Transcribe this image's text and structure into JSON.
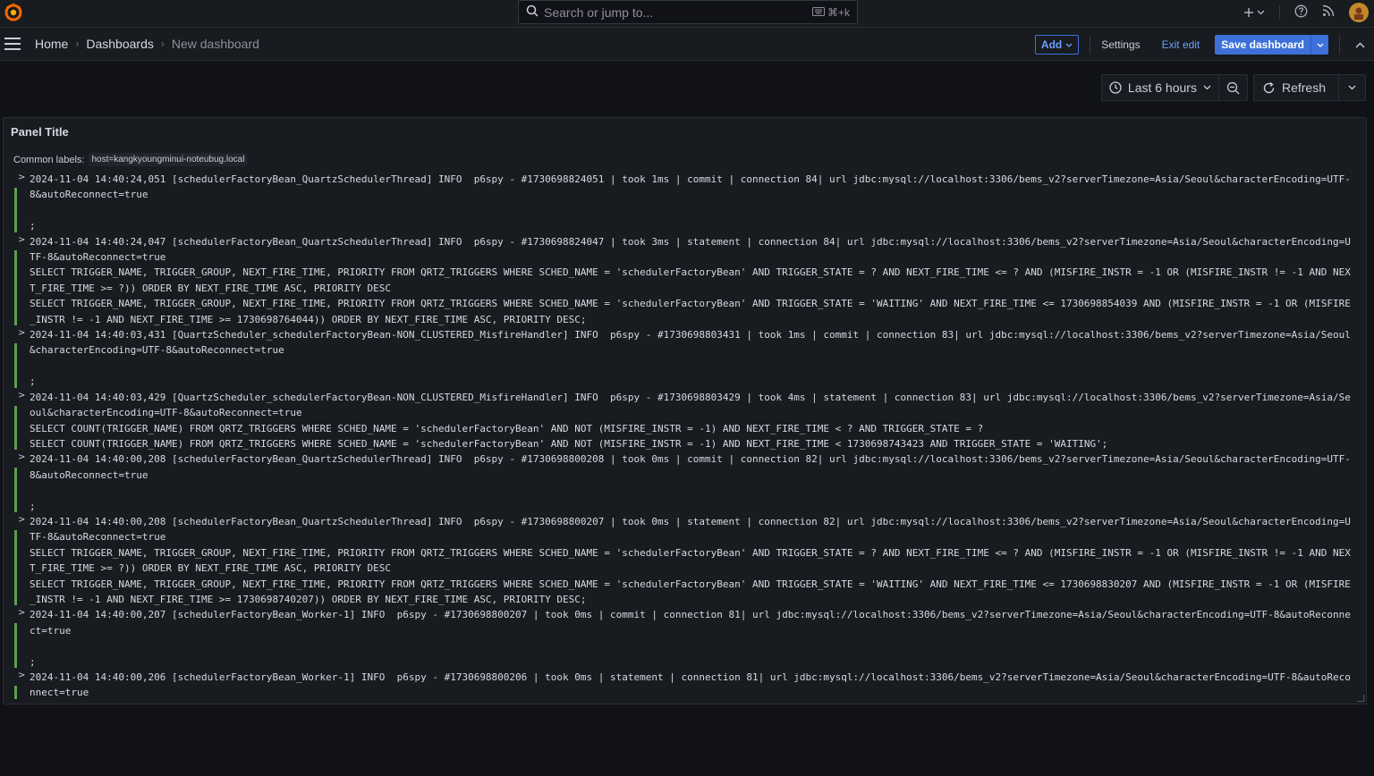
{
  "search": {
    "placeholder": "Search or jump to...",
    "shortcut": "⌘+k"
  },
  "topbar": {
    "add_icon": "plus-icon",
    "help_icon": "help-icon",
    "news_icon": "rss-icon"
  },
  "breadcrumb": {
    "home": "Home",
    "dashboards": "Dashboards",
    "current": "New dashboard"
  },
  "toolbar": {
    "add_label": "Add",
    "settings_label": "Settings",
    "exit_label": "Exit edit",
    "save_label": "Save dashboard"
  },
  "timepicker": {
    "range_label": "Last 6 hours",
    "refresh_label": "Refresh"
  },
  "panel": {
    "title": "Panel Title",
    "common_labels_label": "Common labels:",
    "common_label_value": "host=kangkyoungminui-noteubug.local"
  },
  "colors": {
    "accent": "#3d71d9",
    "log_level_info": "#5c9e52",
    "background": "#111217"
  },
  "logs": [
    {
      "text": "2024-11-04 14:40:24,051 [schedulerFactoryBean_QuartzSchedulerThread] INFO  p6spy - #1730698824051 | took 1ms | commit | connection 84| url jdbc:mysql://localhost:3306/bems_v2?serverTimezone=Asia/Seoul&characterEncoding=UTF-8&autoReconnect=true\n\n;"
    },
    {
      "text": "2024-11-04 14:40:24,047 [schedulerFactoryBean_QuartzSchedulerThread] INFO  p6spy - #1730698824047 | took 3ms | statement | connection 84| url jdbc:mysql://localhost:3306/bems_v2?serverTimezone=Asia/Seoul&characterEncoding=UTF-8&autoReconnect=true\nSELECT TRIGGER_NAME, TRIGGER_GROUP, NEXT_FIRE_TIME, PRIORITY FROM QRTZ_TRIGGERS WHERE SCHED_NAME = 'schedulerFactoryBean' AND TRIGGER_STATE = ? AND NEXT_FIRE_TIME <= ? AND (MISFIRE_INSTR = -1 OR (MISFIRE_INSTR != -1 AND NEXT_FIRE_TIME >= ?)) ORDER BY NEXT_FIRE_TIME ASC, PRIORITY DESC\nSELECT TRIGGER_NAME, TRIGGER_GROUP, NEXT_FIRE_TIME, PRIORITY FROM QRTZ_TRIGGERS WHERE SCHED_NAME = 'schedulerFactoryBean' AND TRIGGER_STATE = 'WAITING' AND NEXT_FIRE_TIME <= 1730698854039 AND (MISFIRE_INSTR = -1 OR (MISFIRE_INSTR != -1 AND NEXT_FIRE_TIME >= 1730698764044)) ORDER BY NEXT_FIRE_TIME ASC, PRIORITY DESC;"
    },
    {
      "text": "2024-11-04 14:40:03,431 [QuartzScheduler_schedulerFactoryBean-NON_CLUSTERED_MisfireHandler] INFO  p6spy - #1730698803431 | took 1ms | commit | connection 83| url jdbc:mysql://localhost:3306/bems_v2?serverTimezone=Asia/Seoul&characterEncoding=UTF-8&autoReconnect=true\n\n;"
    },
    {
      "text": "2024-11-04 14:40:03,429 [QuartzScheduler_schedulerFactoryBean-NON_CLUSTERED_MisfireHandler] INFO  p6spy - #1730698803429 | took 4ms | statement | connection 83| url jdbc:mysql://localhost:3306/bems_v2?serverTimezone=Asia/Seoul&characterEncoding=UTF-8&autoReconnect=true\nSELECT COUNT(TRIGGER_NAME) FROM QRTZ_TRIGGERS WHERE SCHED_NAME = 'schedulerFactoryBean' AND NOT (MISFIRE_INSTR = -1) AND NEXT_FIRE_TIME < ? AND TRIGGER_STATE = ?\nSELECT COUNT(TRIGGER_NAME) FROM QRTZ_TRIGGERS WHERE SCHED_NAME = 'schedulerFactoryBean' AND NOT (MISFIRE_INSTR = -1) AND NEXT_FIRE_TIME < 1730698743423 AND TRIGGER_STATE = 'WAITING';"
    },
    {
      "text": "2024-11-04 14:40:00,208 [schedulerFactoryBean_QuartzSchedulerThread] INFO  p6spy - #1730698800208 | took 0ms | commit | connection 82| url jdbc:mysql://localhost:3306/bems_v2?serverTimezone=Asia/Seoul&characterEncoding=UTF-8&autoReconnect=true\n\n;"
    },
    {
      "text": "2024-11-04 14:40:00,208 [schedulerFactoryBean_QuartzSchedulerThread] INFO  p6spy - #1730698800207 | took 0ms | statement | connection 82| url jdbc:mysql://localhost:3306/bems_v2?serverTimezone=Asia/Seoul&characterEncoding=UTF-8&autoReconnect=true\nSELECT TRIGGER_NAME, TRIGGER_GROUP, NEXT_FIRE_TIME, PRIORITY FROM QRTZ_TRIGGERS WHERE SCHED_NAME = 'schedulerFactoryBean' AND TRIGGER_STATE = ? AND NEXT_FIRE_TIME <= ? AND (MISFIRE_INSTR = -1 OR (MISFIRE_INSTR != -1 AND NEXT_FIRE_TIME >= ?)) ORDER BY NEXT_FIRE_TIME ASC, PRIORITY DESC\nSELECT TRIGGER_NAME, TRIGGER_GROUP, NEXT_FIRE_TIME, PRIORITY FROM QRTZ_TRIGGERS WHERE SCHED_NAME = 'schedulerFactoryBean' AND TRIGGER_STATE = 'WAITING' AND NEXT_FIRE_TIME <= 1730698830207 AND (MISFIRE_INSTR = -1 OR (MISFIRE_INSTR != -1 AND NEXT_FIRE_TIME >= 1730698740207)) ORDER BY NEXT_FIRE_TIME ASC, PRIORITY DESC;"
    },
    {
      "text": "2024-11-04 14:40:00,207 [schedulerFactoryBean_Worker-1] INFO  p6spy - #1730698800207 | took 0ms | commit | connection 81| url jdbc:mysql://localhost:3306/bems_v2?serverTimezone=Asia/Seoul&characterEncoding=UTF-8&autoReconnect=true\n\n;"
    },
    {
      "text": "2024-11-04 14:40:00,206 [schedulerFactoryBean_Worker-1] INFO  p6spy - #1730698800206 | took 0ms | statement | connection 81| url jdbc:mysql://localhost:3306/bems_v2?serverTimezone=Asia/Seoul&characterEncoding=UTF-8&autoReconnect=true"
    }
  ]
}
